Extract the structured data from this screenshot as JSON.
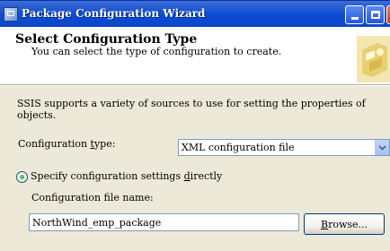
{
  "window": {
    "title": "Package Configuration Wizard",
    "icon": "wizard-app-icon",
    "controls": [
      "minimize-icon",
      "maximize-icon",
      "close-icon"
    ]
  },
  "header": {
    "title": "Select Configuration Type",
    "subtitle": "You can select the type of configuration to create."
  },
  "body": {
    "intro": "SSIS supports a variety of sources to use for setting the properties of objects.",
    "config_type": {
      "label_prefix": "Configuration ",
      "label_accesskey": "t",
      "label_suffix": "ype:",
      "selected": "XML configuration file"
    },
    "specify_option": {
      "label_prefix": "Specify configuration settings ",
      "label_accesskey": "d",
      "label_suffix": "irectly",
      "checked": true
    },
    "file_name": {
      "label": "Configuration file name:",
      "value": "NorthWind_emp_package"
    },
    "browse_button": {
      "label_accesskey": "B",
      "label_suffix": "rowse..."
    }
  },
  "colors": {
    "titlebar": "#0a4bd6",
    "dialog_bg": "#ece9d8",
    "header_bg": "#ffffff",
    "field_border": "#7f9db9"
  }
}
